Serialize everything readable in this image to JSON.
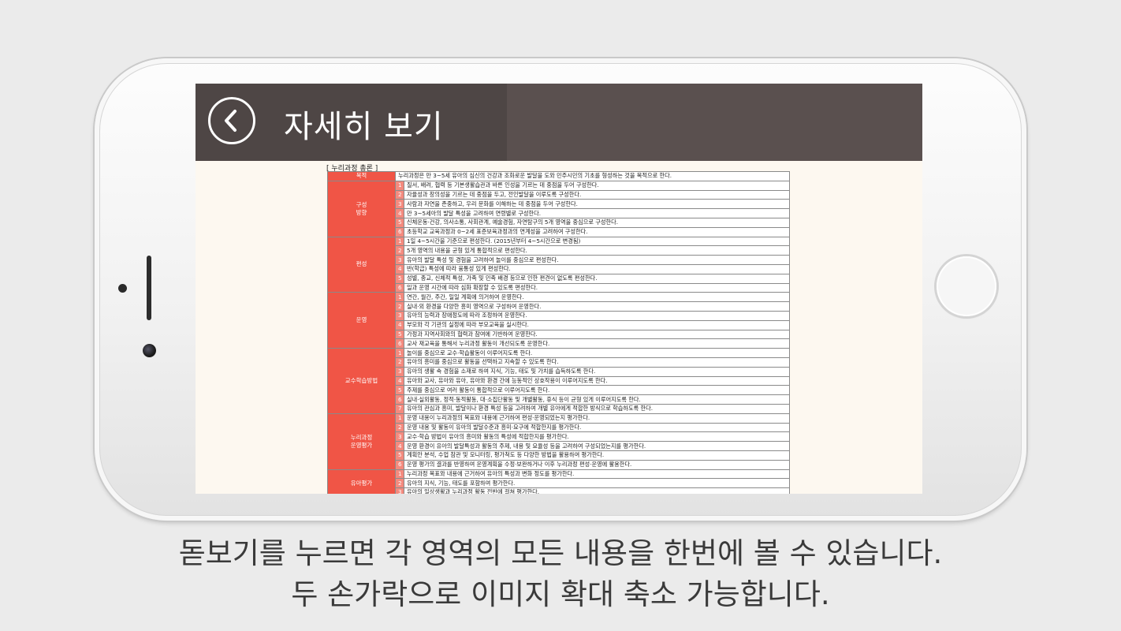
{
  "header": {
    "title": "자세히 보기"
  },
  "sheet": {
    "title": "[ 누리과정 총론 ]"
  },
  "purpose": {
    "label": "목적",
    "text": "누리과정은 만 3~5세 유아의 심신의 건강과 조화로운 발달을 도와 민주시민의 기초를 형성하는 것을 목적으로 한다."
  },
  "sections": [
    {
      "label": "구성\n방향",
      "items": [
        "질서, 배려, 협력 등 기본생활습관과 바른 인성을 기르는 데 중점을 두어 구성한다.",
        "자율성과 창의성을 기르는 데 중점을 두고, 전인발달을 이루도록 구성한다.",
        "사람과 자연을 존중하고, 우리 문화를 이해하는 데 중점을 두어 구성한다.",
        "만 3~5세아의 발달 특성을 고려하여 연령별로 구성한다.",
        "신체운동·건강, 의사소통, 사회관계, 예술경험, 자연탐구의 5개 영역을 중심으로 구성한다.",
        "초등학교 교육과정과 0~2세 표준보육과정과의 연계성을 고려하여 구성한다."
      ]
    },
    {
      "label": "편성",
      "items": [
        "1일 4~5시간을 기준으로 편성한다. (2015년부터 4~5시간으로 변경됨)",
        "5개 영역의 내용을 균형 있게 통합적으로 편성한다.",
        "유아의 발달 특성 및 경험을 고려하여 놀이를 중심으로 편성한다.",
        "반(학급) 특성에 따라 융통성 있게 편성한다.",
        "성별, 종교, 신체적 특성, 가족 및 민족 배경 등으로 인한 편견이 없도록 편성한다.",
        "일과 운영 시간에 따라 심화 확장할 수 있도록 편성한다."
      ]
    },
    {
      "label": "운영",
      "items": [
        "연간, 월간, 주간, 일일 계획에 의거하여 운영한다.",
        "실내·외 환경을 다양한 흥미 영역으로 구성하여 운영한다.",
        "유아의 능력과 장애정도에 따라 조정하여 운영한다.",
        "부모와 각 기관의 실정에 따라 부모교육을 실시한다.",
        "가정과 지역사회와의 협력과 참여에 기반하여 운영한다.",
        "교사 재교육을 통해서 누리과정 활동이 개선되도록 운영한다."
      ]
    },
    {
      "label": "교수학습방법",
      "items": [
        "놀이를 중심으로 교수·학습활동이 이루어지도록 한다.",
        "유아의 흥미를 중심으로 활동을 선택하고 지속할 수 있도록 한다.",
        "유아의 생활 속 경험을 소재로 하여 지식, 기능, 태도 및 가치를 습득하도록 한다.",
        "유아와 교사, 유아와 유아, 유아와 환경 간에 능동적인 상호작용이 이루어지도록 한다.",
        "주제를 중심으로 여러 활동이 통합적으로 이루어지도록 한다.",
        "실내·실외활동, 정적·동적활동, 대·소집단활동 및 개별활동, 휴식 등이 균형 있게 이루어지도록 한다.",
        "유아의 관심과 흥미, 발달이나 환경 특성 등을 고려하여 개별 유아에게 적합한 방식으로 학습하도록 한다."
      ]
    },
    {
      "label": "누리과정\n운영평가",
      "items": [
        "운영 내용이 누리과정의 목표와 내용에 근거하여 편성·운영되었는지 평가한다.",
        "운영 내용 및 활동이 유아의 발달수준과 흥미·요구에 적합한지를 평가한다.",
        "교수·학습 방법이 유아의 흥미와 활동의 특성에 적합한지를 평가한다.",
        "운영 환경이 유아의 발달특성과 활동의 주제, 내용 및 요율성 등을 고려하여 구성되었는지를 평가한다.",
        "계획안 분석, 수업 참관 및 모니터링, 평가척도 등 다양한 방법을 활용하여 평가한다.",
        "운영 평가의 결과를 반영하여 운영계획을 수정·보완하거나 이후 누리과정 편성·운영에 활용한다."
      ]
    },
    {
      "label": "유아평가",
      "items": [
        "누리과정 목표와 내용에 근거하여 유아의 특성과 변화 정도를 평가한다.",
        "유아의 지식, 기능, 태도를 포함하여 평가한다.",
        "유아의 일상생활과 누리과정 활동 전반에 걸쳐 평가한다."
      ]
    }
  ],
  "caption": {
    "line1": "돋보기를 누르면 각 영역의 모든 내용을 한번에 볼 수 있습니다.",
    "line2": "두 손가락으로 이미지 확대 축소 가능합니다."
  }
}
